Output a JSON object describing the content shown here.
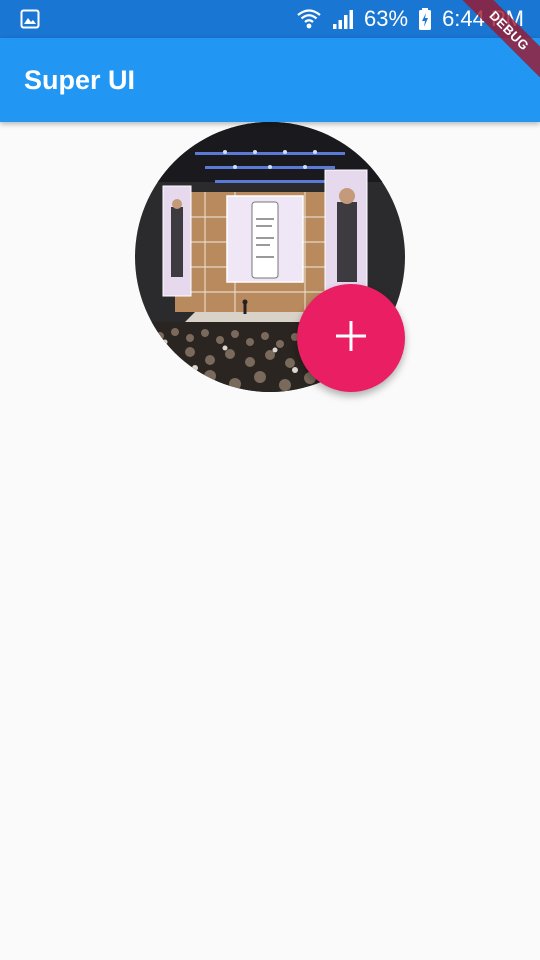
{
  "status_bar": {
    "left_icon": "image-icon",
    "wifi_icon": "wifi-icon",
    "signal_icon": "signal-icon",
    "battery_percent": "63%",
    "battery_icon": "battery-charging-icon",
    "time": "6:44 PM"
  },
  "app_bar": {
    "title": "Super UI"
  },
  "avatar": {
    "description_icon": "conference-stage-image"
  },
  "fab": {
    "icon": "plus-icon"
  },
  "debug_banner": {
    "label": "DEBUG"
  },
  "colors": {
    "status_bar": "#1976d2",
    "app_bar": "#2196f3",
    "fab": "#e91e63",
    "background": "#fafafa"
  }
}
